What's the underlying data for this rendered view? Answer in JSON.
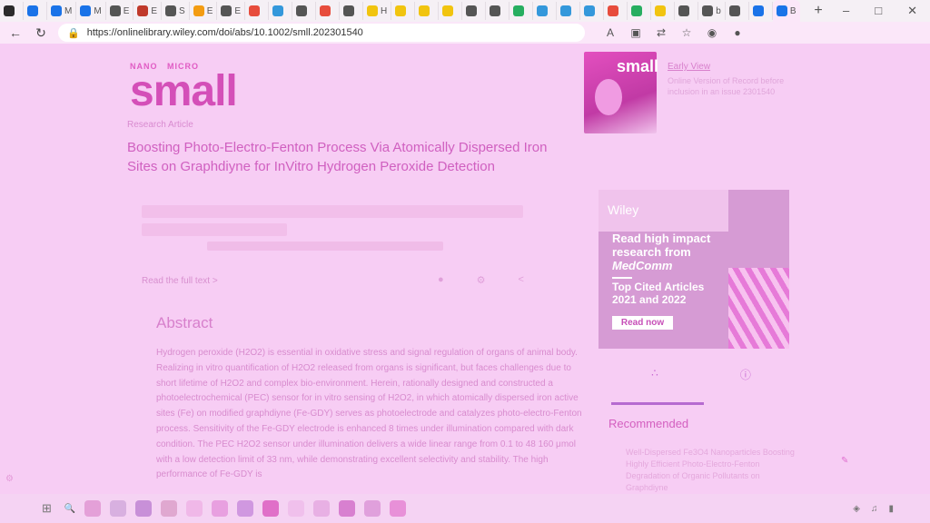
{
  "browser": {
    "tabs": [
      {
        "label": "",
        "color": "#2b2b2b"
      },
      {
        "label": "",
        "color": "#1a73e8"
      },
      {
        "label": "M",
        "color": "#1a73e8"
      },
      {
        "label": "M",
        "color": "#1a73e8"
      },
      {
        "label": "E",
        "color": "#555555"
      },
      {
        "label": "E",
        "color": "#c0392b"
      },
      {
        "label": "S",
        "color": "#555555"
      },
      {
        "label": "E",
        "color": "#f39c12"
      },
      {
        "label": "E",
        "color": "#555555"
      },
      {
        "label": "",
        "color": "#e74c3c"
      },
      {
        "label": "",
        "color": "#3498db"
      },
      {
        "label": "",
        "color": "#555555"
      },
      {
        "label": "",
        "color": "#e74c3c"
      },
      {
        "label": "",
        "color": "#555555"
      },
      {
        "label": "H",
        "color": "#f1c40f"
      },
      {
        "label": "",
        "color": "#f1c40f"
      },
      {
        "label": "",
        "color": "#f1c40f"
      },
      {
        "label": "",
        "color": "#f1c40f"
      },
      {
        "label": "",
        "color": "#555555"
      },
      {
        "label": "",
        "color": "#555555"
      },
      {
        "label": "",
        "color": "#27ae60"
      },
      {
        "label": "",
        "color": "#3498db"
      },
      {
        "label": "",
        "color": "#3498db"
      },
      {
        "label": "",
        "color": "#3498db"
      },
      {
        "label": "",
        "color": "#e74c3c"
      },
      {
        "label": "",
        "color": "#27ae60"
      },
      {
        "label": "",
        "color": "#f1c40f"
      },
      {
        "label": "",
        "color": "#555555"
      },
      {
        "label": "b",
        "color": "#555555"
      },
      {
        "label": "",
        "color": "#555555"
      },
      {
        "label": "",
        "color": "#1a73e8"
      },
      {
        "label": "B",
        "color": "#1a73e8"
      }
    ],
    "new_tab": "+",
    "url": "https://onlinelibrary.wiley.com/doi/abs/10.1002/smll.202301540"
  },
  "journal": {
    "kicker_nano": "NANO",
    "kicker_micro": "MICRO",
    "name": "small"
  },
  "article": {
    "type": "Research Article",
    "title": "Boosting Photo-Electro-Fenton Process Via Atomically Dispersed Iron Sites on Graphdiyne for InVitro Hydrogen Peroxide Detection",
    "read_full": "Read the full text >",
    "abstract_heading": "Abstract",
    "abstract": "Hydrogen peroxide (H2O2) is essential in oxidative stress and signal regulation of organs of animal body. Realizing in vitro quantification of H2O2 released from organs is significant, but faces challenges due to short lifetime of H2O2 and complex bio-environment. Herein, rationally designed and constructed a photoelectrochemical (PEC) sensor for in vitro sensing of H2O2, in which atomically dispersed iron active sites (Fe) on modified graphdiyne (Fe-GDY) serves as photoelectrode and catalyzes photo-electro-Fenton process. Sensitivity of the Fe-GDY electrode is enhanced 8 times under illumination compared with dark condition. The PEC H2O2 sensor under illumination delivers a wide linear range from 0.1 to 48 160 μmol with a low detection limit of 33 nm, while demonstrating excellent selectivity and stability. The high performance of Fe-GDY is"
  },
  "sidebar": {
    "cover_word": "small",
    "early_view_title": "Early View",
    "early_view_desc": "Online Version of Record before inclusion in an issue 2301540",
    "ad": {
      "brand": "Wiley",
      "headline_1": "Read high impact research from",
      "headline_em": "MedComm",
      "sub": "Top Cited Articles 2021 and 2022",
      "button": "Read now"
    },
    "recommended_heading": "Recommended",
    "recommended_item": "Well-Dispersed Fe3O4 Nanoparticles Boosting Highly Efficient Photo-Electro-Fenton Degradation of Organic Pollutants on Graphdiyne"
  },
  "colors": {
    "page_bg": "#f7cdf4",
    "accent": "#d460c0"
  }
}
